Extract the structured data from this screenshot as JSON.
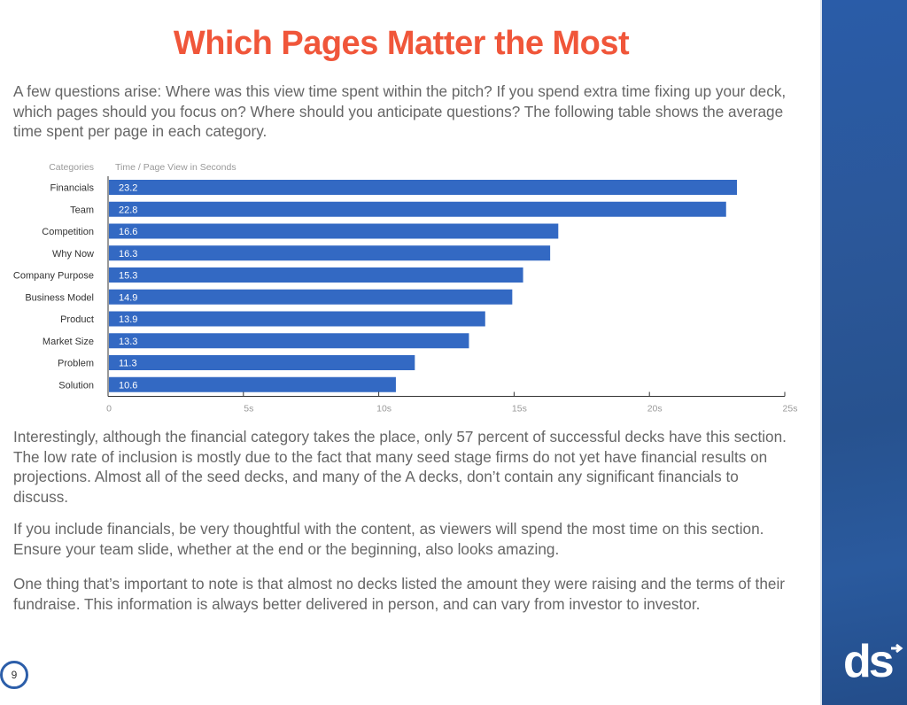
{
  "slide": {
    "title": "Which Pages Matter the Most",
    "intro": "A few questions arise: Where was this view time spent within the pitch? If you spend extra time fixing up your deck, which pages should you focus on? Where should you anticipate questions? The following table shows the average time spent per page in each category.",
    "paragraphs": [
      "Interestingly, although the financial category takes the place, only 57 percent of successful decks have this section. The low rate of inclusion is mostly due to the fact that many seed stage firms do not yet have financial results on projections. Almost all of the seed decks, and many of the A decks, don’t contain any significant financials to discuss.",
      "If you include financials, be very thoughtful with the content, as viewers will spend the most time on this section. Ensure your team slide, whether at the end or the beginning, also looks amazing.",
      "One thing that’s important to note is that almost no decks listed the amount they were raising and the terms of their fundraise. This information is always better delivered in person, and can vary from investor to investor."
    ],
    "page_number": "9",
    "logo_text": "ds"
  },
  "colors": {
    "title": "#f0563a",
    "bar": "#3369c3",
    "sidebar": "#2a5aa0",
    "page_ring": "#2c5ea9"
  },
  "chart_data": {
    "type": "bar",
    "orientation": "horizontal",
    "title": "",
    "category_header": "Categories",
    "value_header": "Time / Page View in Seconds",
    "categories": [
      "Financials",
      "Team",
      "Competition",
      "Why Now",
      "Company Purpose",
      "Business Model",
      "Product",
      "Market Size",
      "Problem",
      "Solution"
    ],
    "values": [
      23.2,
      22.8,
      16.6,
      16.3,
      15.3,
      14.9,
      13.9,
      13.3,
      11.3,
      10.6
    ],
    "data_labels": [
      "23.2",
      "22.8",
      "16.6",
      "16.3",
      "15.3",
      "14.9",
      "13.9",
      "13.3",
      "11.3",
      "10.6"
    ],
    "xlim": [
      0,
      25
    ],
    "x_ticks": [
      0,
      5,
      10,
      15,
      20,
      25
    ],
    "x_tick_labels": [
      "0",
      "5s",
      "10s",
      "15s",
      "20s",
      "25s"
    ],
    "xlabel": "",
    "ylabel": "",
    "grid": false,
    "legend": "none"
  }
}
